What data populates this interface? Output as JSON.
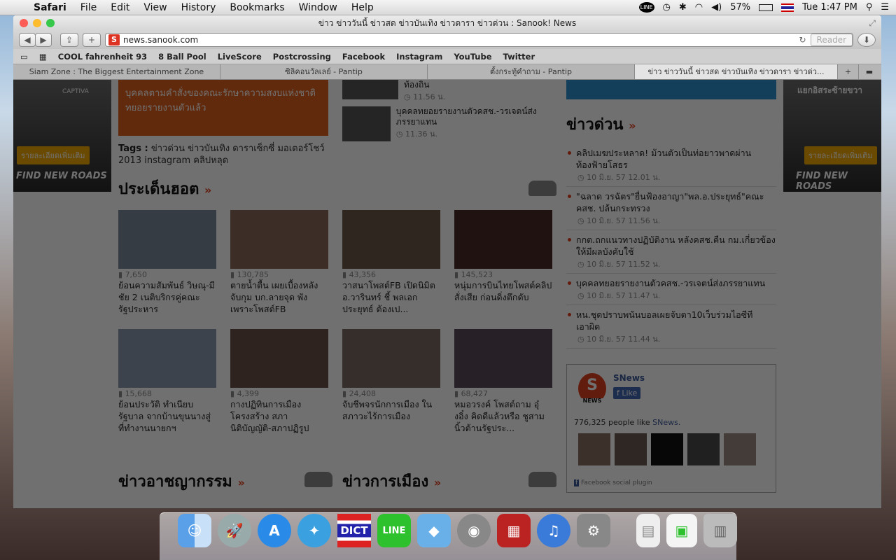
{
  "menubar": {
    "app": "Safari",
    "items": [
      "File",
      "Edit",
      "View",
      "History",
      "Bookmarks",
      "Window",
      "Help"
    ],
    "battery": "57%",
    "clock": "Tue 1:47 PM"
  },
  "window": {
    "title": "ข่าว ข่าววันนี้ ข่าวสด ข่าวบันเทิง ข่าวดารา ข่าวด่วน : Sanook! News",
    "url": "news.sanook.com",
    "reader": "Reader",
    "bookmarks": [
      "COOL fahrenheit 93",
      "8 Ball Pool",
      "LiveScore",
      "Postcrossing",
      "Facebook",
      "Instagram",
      "YouTube",
      "Twitter"
    ],
    "tabs": [
      {
        "label": "Siam Zone : The Biggest Entertainment Zone"
      },
      {
        "label": "ซิลิคอนวัลเลย์ - Pantip"
      },
      {
        "label": "ตั้งกระทู้คำถาม - Pantip"
      },
      {
        "label": "ข่าว ข่าววันนี้ ข่าวสด ข่าวบันเทิง ข่าวดารา ข่าวด่ว..."
      }
    ]
  },
  "ads": {
    "left": {
      "button": "รายละเอียดเพิ่มเติม",
      "slogan": "FIND NEW ROADS",
      "model": "CAPTIVA"
    },
    "right": {
      "button": "รายละเอียดเพิ่มเติม",
      "slogan": "FIND NEW ROADS",
      "caption": "แยกอิสระซ้ายขวา"
    }
  },
  "main": {
    "headline": "บุคคลตามคำสั่งของคณะรักษาความสงบแห่งชาติ ทยอยรายงานตัวแล้ว",
    "tags_label": "Tags :",
    "tags": "ข่าวด่วน ข่าวบันเทิง ดาราเซ็กซี่ มอเตอร์โชว์ 2013 instagram คลิปหลุด",
    "small_news": [
      {
        "title": "ท้องถิ่น",
        "time": "11.56 น."
      },
      {
        "title": "บุคคลทยอยรายงานตัวคสช.-วรเจตน์ส่งภรรยาแทน",
        "time": "11.36 น."
      }
    ],
    "hot_title": "ประเด็นฮอต",
    "hot": [
      {
        "views": "7,650",
        "title": "ย้อนความสัมพันธ์ วิษณุ-มีชัย 2 เนติบริกรคู่คณะรัฐประหาร"
      },
      {
        "views": "130,785",
        "title": "ตายน้ำตื้น เผยเบื้องหลังจับกุม บก.ลายจุด พังเพราะโพสต์FB"
      },
      {
        "views": "43,356",
        "title": "วาสนาโพสต์FB เปิดนิมิต อ.วารินทร์ ชี้ พลเอก ประยุทธ์ ต้องเป..."
      },
      {
        "views": "145,523",
        "title": "หนุ่มการบินไทยโพสต์คลิปสั่งเสีย ก่อนดิ่งตึกดับ"
      },
      {
        "views": "15,668",
        "title": "ย้อนประวัติ ทำเนียบรัฐบาล จากบ้านขุนนางสู่ที่ทำงานนายกฯ"
      },
      {
        "views": "4,399",
        "title": "กางปฏิทินการเมือง โครงสร้าง สภานิติบัญญัติ-สภาปฏิรูป"
      },
      {
        "views": "24,408",
        "title": "จับชีพจรนักการเมือง ในสภาวะไร้การเมือง"
      },
      {
        "views": "68,427",
        "title": "หมอวรงค์ โพสต์ถาม อุ๋งอิ๋ง คิดดีแล้วหรือ ชูสามนิ้วต้านรัฐประ..."
      }
    ],
    "crime_title": "ข่าวอาชญากรรม",
    "politics_title": "ข่าวการเมือง"
  },
  "sidebar": {
    "breaking_title": "ข่าวด่วน",
    "breaking": [
      {
        "title": "คลิปเมฆประหลาด! ม้วนตัวเป็นท่อยาวพาดผ่านท้องฟ้ายโสธร",
        "time": "10 มิ.ย. 57 12.01 น."
      },
      {
        "title": "\"ฉลาด วรฉัตร\"ยื่นฟ้องอาญา\"พล.อ.ประยุทธ์\"คณะคสช. ปล้นกระทรวง",
        "time": "10 มิ.ย. 57 11.56 น."
      },
      {
        "title": "กกต.ถกแนวทางปฏิบัติงาน หลังคสช.คืน กม.เกี่ยวข้องให้มีผลบังคับใช้",
        "time": "10 มิ.ย. 57 11.52 น."
      },
      {
        "title": "บุคคลทยอยรายงานตัวคสช.-วรเจตน์ส่งภรรยาแทน",
        "time": "10 มิ.ย. 57 11.47 น."
      },
      {
        "title": "หน.ชุดปราบพนันบอลเผยจับตา10เว็บร่วมไอซีทีเอาผิด",
        "time": "10 มิ.ย. 57 11.44 น."
      }
    ],
    "fb": {
      "name": "SNews",
      "logo": "S",
      "logo_caption": "NEWS",
      "like": "Like",
      "count": "776,325 people like ",
      "count_name": "SNews.",
      "plugin": "Facebook social plugin"
    }
  },
  "dock": {
    "dict": "DICT",
    "line": "LINE"
  }
}
